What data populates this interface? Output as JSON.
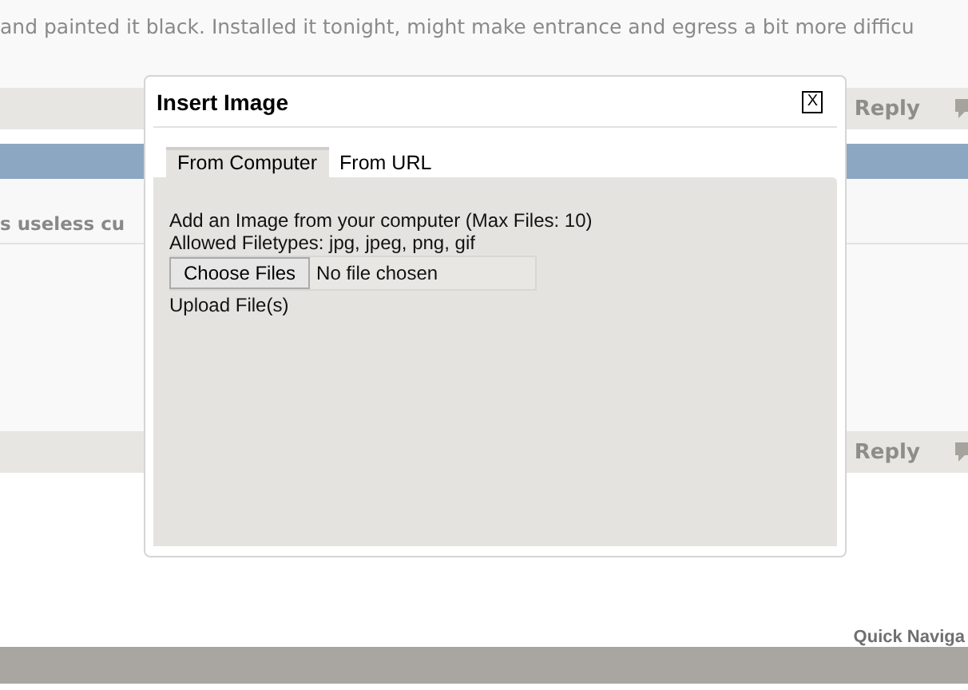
{
  "post_text": [
    "and painted it black. Installed it tonight, might make entrance and egress a bit more difficu"
  ],
  "post_bars": [
    {
      "action": "Reply"
    },
    {
      "action": "Reply"
    }
  ],
  "thread_title": "s useless cu",
  "quick_navigation": "Quick Naviga",
  "dialog": {
    "title": "Insert Image",
    "close": "X",
    "tabs": [
      {
        "label": "From Computer",
        "selected": true
      },
      {
        "label": "From URL",
        "selected": false
      }
    ],
    "lines": [
      "Add an Image from your computer (Max Files: 10)",
      "Allowed Filetypes: jpg, jpeg, png, gif"
    ],
    "choose_button": "Choose Files",
    "file_status": "No file chosen",
    "upload_label": "Upload File(s)"
  }
}
